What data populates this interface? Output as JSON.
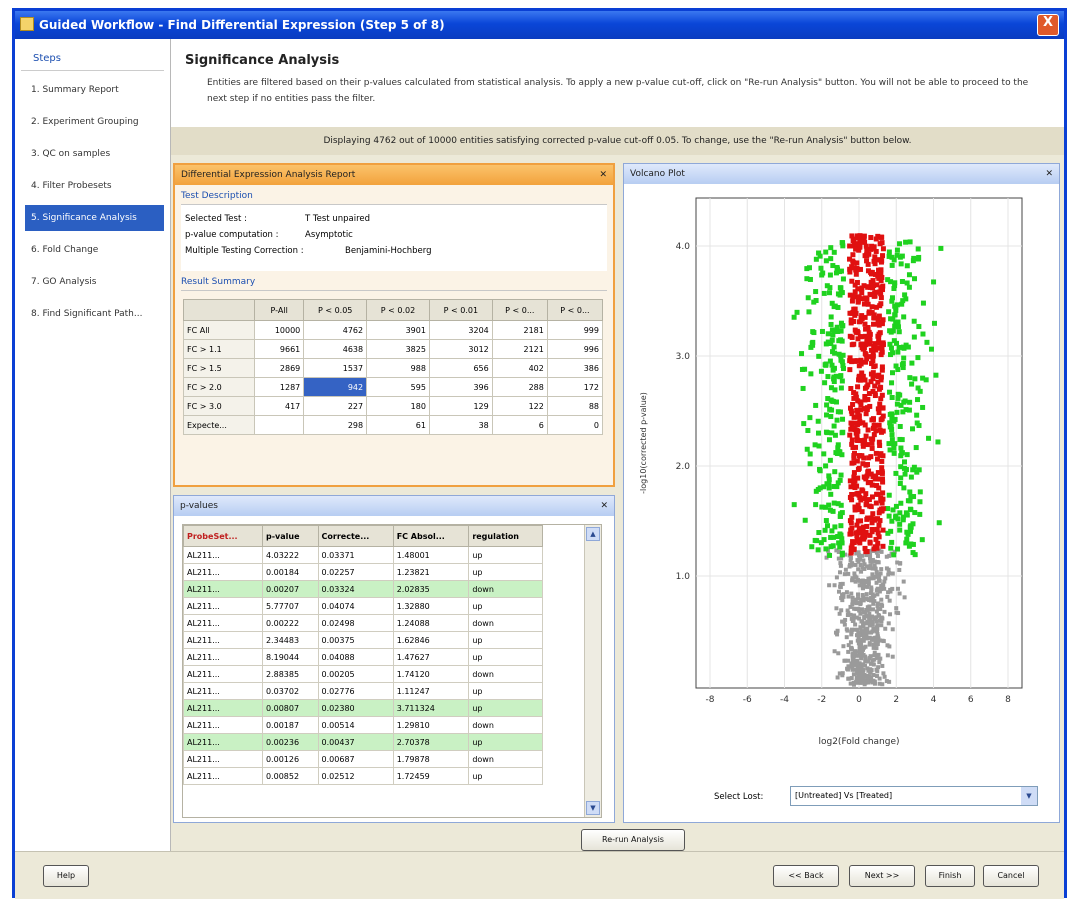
{
  "window": {
    "title": "Guided Workflow - Find Differential Expression (Step 5 of 8)",
    "close": "X"
  },
  "steps": {
    "heading": "Steps",
    "items": [
      "1. Summary Report",
      "2. Experiment Grouping",
      "3. QC on samples",
      "4. Filter Probesets",
      "5. Significance Analysis",
      "6. Fold Change",
      "7. GO Analysis",
      "8. Find Significant Path..."
    ],
    "active_index": 4
  },
  "header": {
    "title": "Significance Analysis",
    "description": "Entities are filtered based on their p-values calculated from statistical analysis. To apply a new p-value cut-off, click on \"Re-run Analysis\" button. You will not be able to proceed to the next step if no entities pass the filter."
  },
  "display_bar": "Displaying 4762 out of 10000 entities satisfying corrected p-value cut-off 0.05. To change, use the \"Re-run Analysis\" button below.",
  "report": {
    "title": "Differential Expression Analysis Report",
    "test_description_heading": "Test Description",
    "rows": [
      {
        "key": "Selected Test :",
        "value": "T Test unpaired"
      },
      {
        "key": "p-value computation :",
        "value": "Asymptotic"
      },
      {
        "key": "Multiple Testing Correction :",
        "value": "Benjamini-Hochberg"
      }
    ],
    "result_summary_heading": "Result Summary",
    "summary_table": {
      "headers": [
        "",
        "P-All",
        "P < 0.05",
        "P < 0.02",
        "P < 0.01",
        "P < 0...",
        "P < 0..."
      ],
      "rows": [
        [
          "FC All",
          "10000",
          "4762",
          "3901",
          "3204",
          "2181",
          "999"
        ],
        [
          "FC > 1.1",
          "9661",
          "4638",
          "3825",
          "3012",
          "2121",
          "996"
        ],
        [
          "FC > 1.5",
          "2869",
          "1537",
          "988",
          "656",
          "402",
          "386"
        ],
        [
          "FC > 2.0",
          "1287",
          "942",
          "595",
          "396",
          "288",
          "172"
        ],
        [
          "FC > 3.0",
          "417",
          "227",
          "180",
          "129",
          "122",
          "88"
        ],
        [
          "Expecte...",
          "",
          "298",
          "61",
          "38",
          "6",
          "0"
        ]
      ],
      "selected_cell": [
        3,
        2
      ]
    }
  },
  "pvalues": {
    "title": "p-values",
    "headers": [
      "ProbeSet...",
      "p-value",
      "Correcte...",
      "FC Absol...",
      "regulation"
    ],
    "rows": [
      {
        "cells": [
          "AL211...",
          "4.03222",
          "0.03371",
          "1.48001",
          "up"
        ],
        "green": false
      },
      {
        "cells": [
          "AL211...",
          "0.00184",
          "0.02257",
          "1.23821",
          "up"
        ],
        "green": false
      },
      {
        "cells": [
          "AL211...",
          "0.00207",
          "0.03324",
          "2.02835",
          "down"
        ],
        "green": true
      },
      {
        "cells": [
          "AL211...",
          "5.77707",
          "0.04074",
          "1.32880",
          "up"
        ],
        "green": false
      },
      {
        "cells": [
          "AL211...",
          "0.00222",
          "0.02498",
          "1.24088",
          "down"
        ],
        "green": false
      },
      {
        "cells": [
          "AL211...",
          "2.34483",
          "0.00375",
          "1.62846",
          "up"
        ],
        "green": false
      },
      {
        "cells": [
          "AL211...",
          "8.19044",
          "0.04088",
          "1.47627",
          "up"
        ],
        "green": false
      },
      {
        "cells": [
          "AL211...",
          "2.88385",
          "0.00205",
          "1.74120",
          "down"
        ],
        "green": false
      },
      {
        "cells": [
          "AL211...",
          "0.03702",
          "0.02776",
          "1.11247",
          "up"
        ],
        "green": false
      },
      {
        "cells": [
          "AL211...",
          "0.00807",
          "0.02380",
          "3.711324",
          "up"
        ],
        "green": true
      },
      {
        "cells": [
          "AL211...",
          "0.00187",
          "0.00514",
          "1.29810",
          "down"
        ],
        "green": false
      },
      {
        "cells": [
          "AL211...",
          "0.00236",
          "0.00437",
          "2.70378",
          "up"
        ],
        "green": true
      },
      {
        "cells": [
          "AL211...",
          "0.00126",
          "0.00687",
          "1.79878",
          "down"
        ],
        "green": false
      },
      {
        "cells": [
          "AL211...",
          "0.00852",
          "0.02512",
          "1.72459",
          "up"
        ],
        "green": false
      }
    ]
  },
  "volcano": {
    "title": "Volcano Plot",
    "xlabel": "log2(Fold change)",
    "ylabel": "-log10(corrected p-value)",
    "x_ticks": [
      "-8",
      "-6",
      "-4",
      "-2",
      "0",
      "2",
      "4",
      "6",
      "8"
    ],
    "y_ticks": [
      "1.0",
      "2.0",
      "3.0",
      "4.0"
    ],
    "colors": {
      "significant_fc": "#1fd21f",
      "significant_low_fc": "#e01010",
      "not_significant": "#9a9a9a"
    },
    "select_label": "Select Lost:",
    "select_value": "[Untreated] Vs [Treated]"
  },
  "buttons": {
    "rerun": "Re-run Analysis",
    "help": "Help",
    "back": "<< Back",
    "next": "Next >>",
    "finish": "Finish",
    "cancel": "Cancel"
  }
}
